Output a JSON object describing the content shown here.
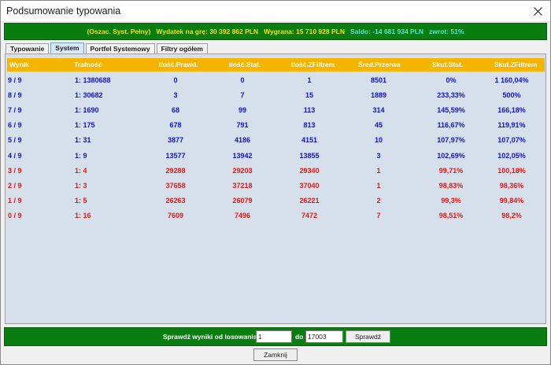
{
  "window": {
    "title": "Podsumowanie typowania"
  },
  "summary": {
    "part1": "(Oszac. Syst. Pełny)",
    "part2": "Wydatek na grę: 30 392 862 PLN",
    "part3": "Wygrana: 15 710 928 PLN",
    "part4": "Saldo: -14 681 934 PLN",
    "part5": "zwrot: 51%"
  },
  "tabs": [
    "Typowanie",
    "System",
    "Portfel Systemowy",
    "Filtry ogółem"
  ],
  "active_tab": "System",
  "table": {
    "headers": [
      "Wynik",
      "Trafność",
      "Ilość.Prawd.",
      "Ilość.Stat.",
      "Ilość.ZFiltrem",
      "Śred.Przerwa",
      "Skut.Stat.",
      "Skut.ZFiltrem"
    ],
    "rows": [
      {
        "color": "blue",
        "cells": [
          "9 / 9",
          "1: 1380688",
          "0",
          "0",
          "1",
          "8501",
          "0%",
          "1 160,04%"
        ]
      },
      {
        "color": "blue",
        "cells": [
          "8 / 9",
          "1: 30682",
          "3",
          "7",
          "15",
          "1889",
          "233,33%",
          "500%"
        ]
      },
      {
        "color": "blue",
        "cells": [
          "7 / 9",
          "1: 1690",
          "68",
          "99",
          "113",
          "314",
          "145,59%",
          "166,18%"
        ]
      },
      {
        "color": "blue",
        "cells": [
          "6 / 9",
          "1: 175",
          "678",
          "791",
          "813",
          "45",
          "116,67%",
          "119,91%"
        ]
      },
      {
        "color": "blue",
        "cells": [
          "5 / 9",
          "1: 31",
          "3877",
          "4186",
          "4151",
          "10",
          "107,97%",
          "107,07%"
        ]
      },
      {
        "color": "blue",
        "cells": [
          "4 / 9",
          "1: 9",
          "13577",
          "13942",
          "13855",
          "3",
          "102,69%",
          "102,05%"
        ]
      },
      {
        "color": "red",
        "cells": [
          "3 / 9",
          "1: 4",
          "29288",
          "29203",
          "29340",
          "1",
          "99,71%",
          "100,18%"
        ]
      },
      {
        "color": "red",
        "cells": [
          "2 / 9",
          "1: 3",
          "37658",
          "37218",
          "37040",
          "1",
          "98,83%",
          "98,36%"
        ]
      },
      {
        "color": "red",
        "cells": [
          "1 / 9",
          "1: 5",
          "26263",
          "26079",
          "26221",
          "2",
          "99,3%",
          "99,84%"
        ]
      },
      {
        "color": "red",
        "cells": [
          "0 / 9",
          "1: 16",
          "7609",
          "7496",
          "7472",
          "7",
          "98,51%",
          "98,2%"
        ]
      }
    ]
  },
  "check": {
    "label": "Sprawdź wyniki od losowania:",
    "from_value": "1",
    "to_label": "do",
    "to_value": "17003",
    "button_label": "Sprawdź"
  },
  "close_button_label": "Zamknij",
  "colors": {
    "green_bar": "#0a7d10",
    "header_orange": "#f5b400",
    "content_bg": "#d6e0ea",
    "blue_text": "#1010d8",
    "red_text": "#e81414",
    "summary_yellow": "#f2e600",
    "summary_cyan": "#5ae6cf"
  },
  "icons": {
    "close": "close-icon"
  }
}
